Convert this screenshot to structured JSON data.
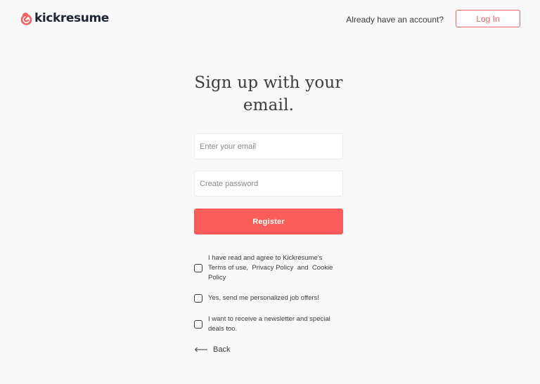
{
  "header": {
    "logo_text": "kickresume",
    "have_account_text": "Already have an account?",
    "login_label": "Log In"
  },
  "form": {
    "title_line1": "Sign up with your",
    "title_line2": "email.",
    "email_placeholder": "Enter your email",
    "password_placeholder": "Create password",
    "register_label": "Register"
  },
  "consents": {
    "terms_prefix": "I have read and agree to Kickresume's",
    "terms_link": "Terms of use,",
    "privacy_link": "Privacy Policy",
    "and_text": "and",
    "cookie_link": "Cookie Policy",
    "offers_text": "Yes, send me personalized job offers!",
    "newsletter_text": "I want to receive a newsletter and special deals too."
  },
  "back_label": "Back",
  "colors": {
    "accent": "#fb5d5a",
    "background": "#f9f9f9",
    "text": "#2a2a2a"
  }
}
